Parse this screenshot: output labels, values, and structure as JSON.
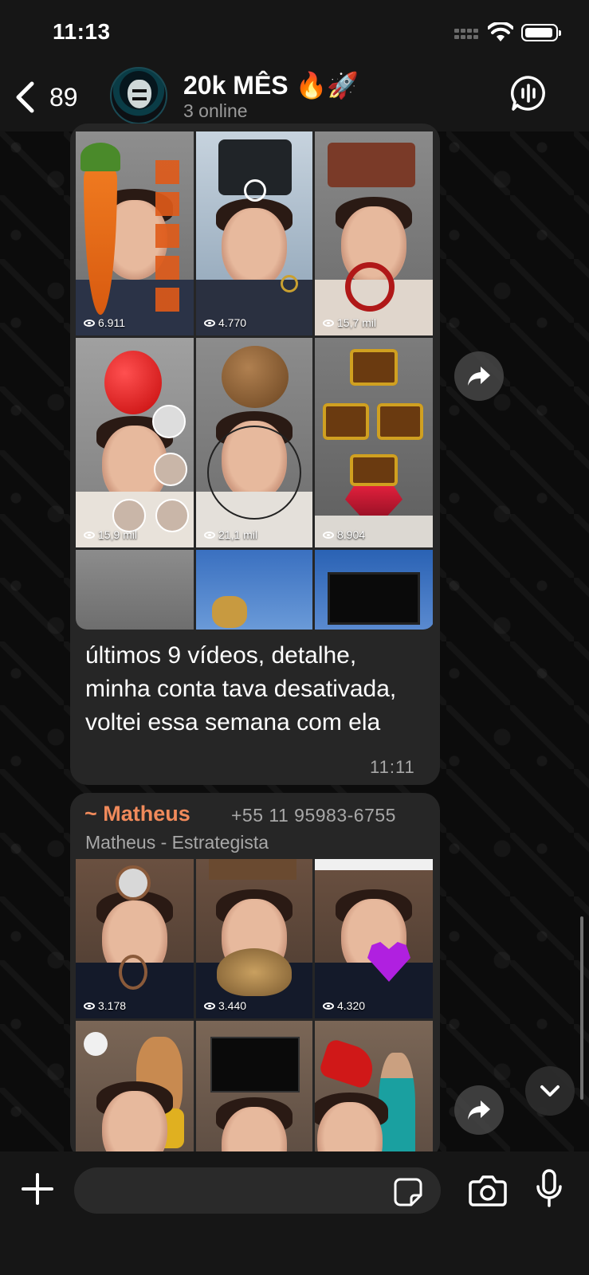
{
  "status_bar": {
    "time": "11:13"
  },
  "header": {
    "back_count": "89",
    "title": "20k MÊS 🔥🚀",
    "subtitle": "3 online"
  },
  "messages": [
    {
      "grid_views": [
        "6.911",
        "4.770",
        "15,7 mil",
        "15,9 mil",
        "21,1 mil",
        "8.904",
        "",
        "",
        ""
      ],
      "caption": "últimos 9 vídeos, detalhe, minha conta tava desativada, voltei essa semana com ela",
      "time": "11:11"
    },
    {
      "sender_name": "~ Matheus",
      "sender_phone": "+55 11 95983-6755",
      "sender_role": "Matheus - Estrategista",
      "grid_views": [
        "3.178",
        "3.440",
        "4.320",
        "",
        "",
        ""
      ]
    }
  ],
  "composer": {
    "placeholder": ""
  },
  "colors": {
    "sender_name": "#f08a5b",
    "bubble": "#262626",
    "header": "#161616"
  },
  "icons": [
    "chevron-left-icon",
    "voice-chat-icon",
    "forward-icon",
    "chevron-down-icon",
    "plus-icon",
    "sticker-icon",
    "camera-icon",
    "mic-icon",
    "eye-icon"
  ]
}
